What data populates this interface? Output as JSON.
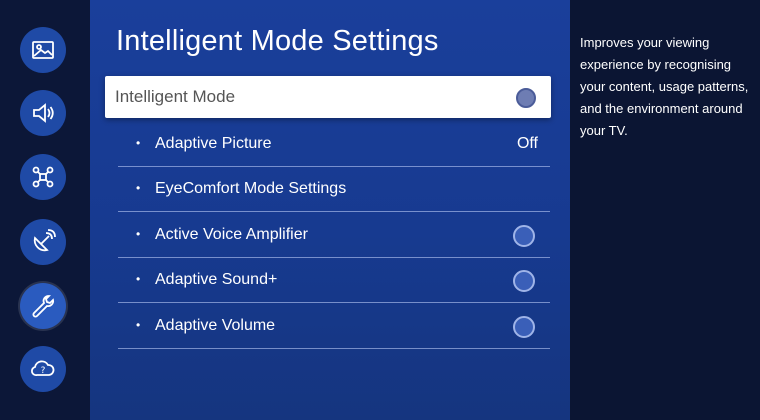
{
  "sidebar": {
    "items": [
      {
        "name": "picture",
        "icon": "picture-icon"
      },
      {
        "name": "sound",
        "icon": "speaker-icon"
      },
      {
        "name": "connection",
        "icon": "network-icon"
      },
      {
        "name": "broadcasting",
        "icon": "satellite-dish-icon"
      },
      {
        "name": "general",
        "icon": "wrench-icon",
        "selected": true
      },
      {
        "name": "support",
        "icon": "help-cloud-icon"
      }
    ]
  },
  "main": {
    "title": "Intelligent Mode Settings",
    "focused": {
      "label": "Intelligent Mode",
      "toggle": "off"
    },
    "items": [
      {
        "bullet": "•",
        "label": "Adaptive Picture",
        "value": "Off"
      },
      {
        "bullet": "•",
        "label": "EyeComfort Mode Settings"
      },
      {
        "bullet": "•",
        "label": "Active Voice Amplifier",
        "toggle": "off"
      },
      {
        "bullet": "•",
        "label": "Adaptive Sound+",
        "toggle": "off"
      },
      {
        "bullet": "•",
        "label": "Adaptive Volume",
        "toggle": "off"
      }
    ]
  },
  "description": {
    "text": "Improves your viewing experience by recognising your content, usage patterns, and the environment around your TV."
  },
  "colors": {
    "background": "#0b1533",
    "panel": "#1a3f9b",
    "icon_circle": "#1f4aa6",
    "focus": "#ffffff"
  }
}
